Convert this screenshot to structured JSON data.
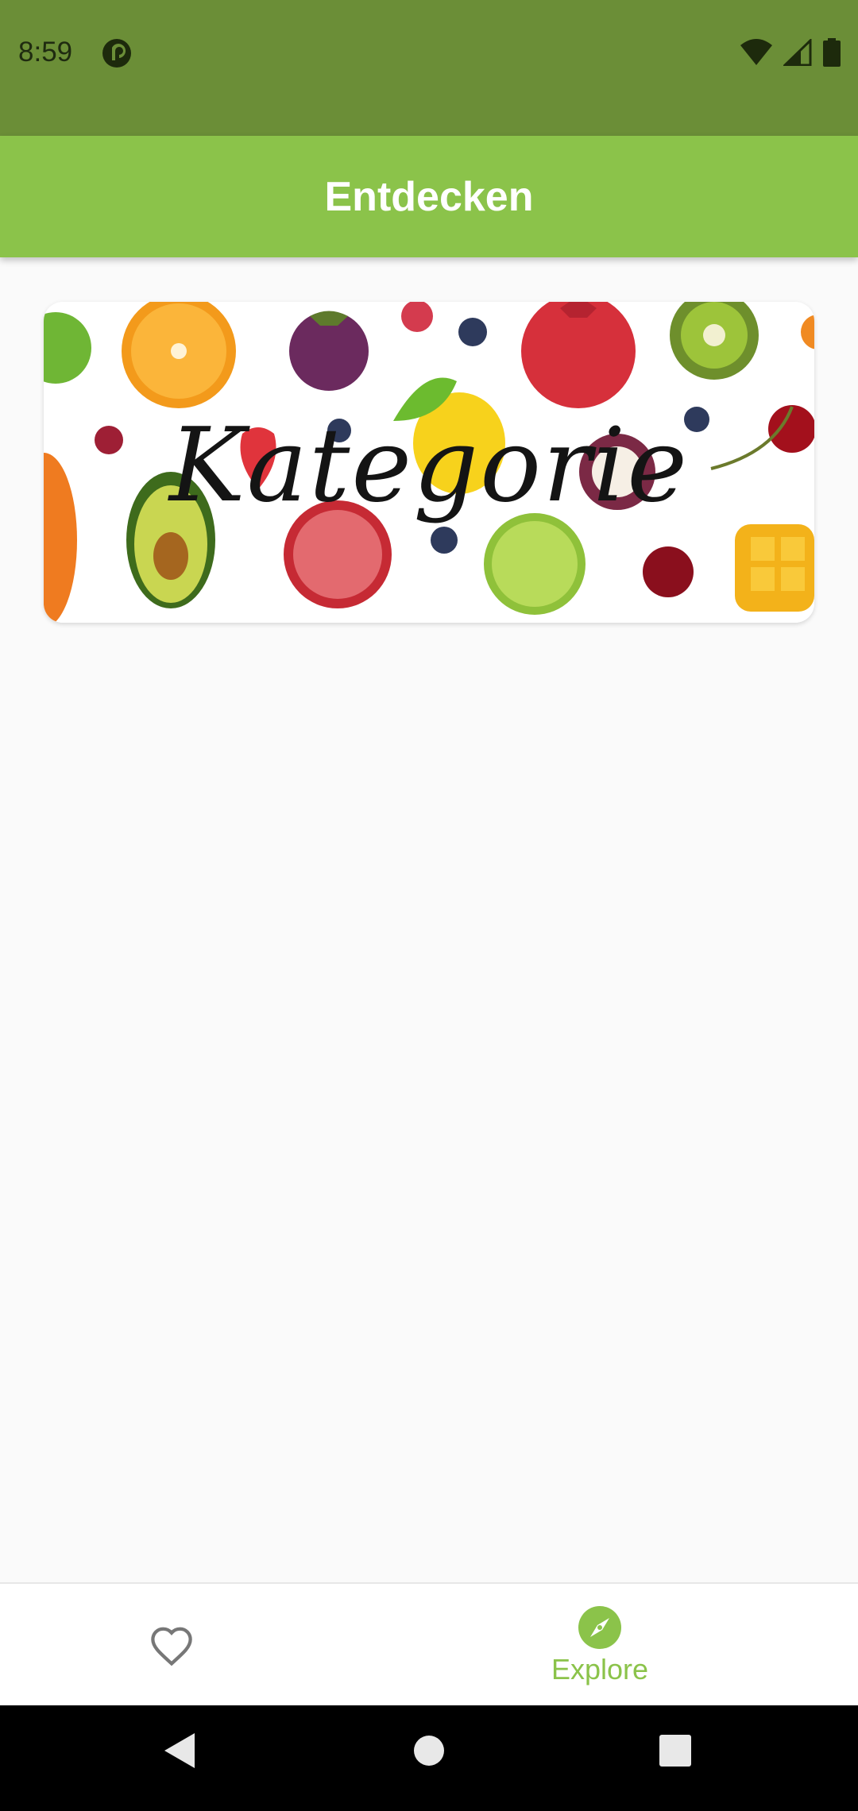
{
  "status_bar": {
    "time": "8:59",
    "app_icon": "pocket-casts-icon",
    "icons": [
      "wifi-icon",
      "cellular-signal-icon",
      "battery-icon"
    ],
    "background": "#6b8e37"
  },
  "app_bar": {
    "title": "Entdecken",
    "background": "#8bc34a"
  },
  "categories": [
    {
      "label": "Kategorie",
      "image": "fruit-collage-image"
    }
  ],
  "bottom_nav": {
    "items": [
      {
        "icon": "heart-outline-icon",
        "label": "",
        "selected": false
      },
      {
        "icon": "compass-icon",
        "label": "Explore",
        "selected": true
      }
    ],
    "active_color": "#8bc34a",
    "inactive_color": "#777777"
  },
  "system_nav": {
    "buttons": [
      "back-icon",
      "home-icon",
      "recents-icon"
    ]
  }
}
